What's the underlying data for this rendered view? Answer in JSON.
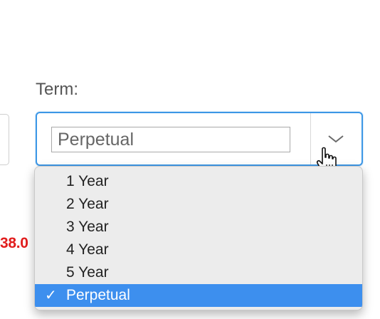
{
  "partial_price": "38.0",
  "term": {
    "label": "Term:",
    "selected_value": "Perpetual",
    "options": [
      {
        "label": "1 Year",
        "selected": false
      },
      {
        "label": "2 Year",
        "selected": false
      },
      {
        "label": "3 Year",
        "selected": false
      },
      {
        "label": "4 Year",
        "selected": false
      },
      {
        "label": "5 Year",
        "selected": false
      },
      {
        "label": "Perpetual",
        "selected": true
      }
    ],
    "check_mark": "✓"
  },
  "colors": {
    "focus_border": "#3d97e6",
    "selected_option_bg": "#3d8fee",
    "price_red": "#e11d1d",
    "dropdown_bg": "#ececec"
  },
  "icons": {
    "arrow": "chevron-down-icon",
    "cursor": "hand-pointer-icon"
  }
}
